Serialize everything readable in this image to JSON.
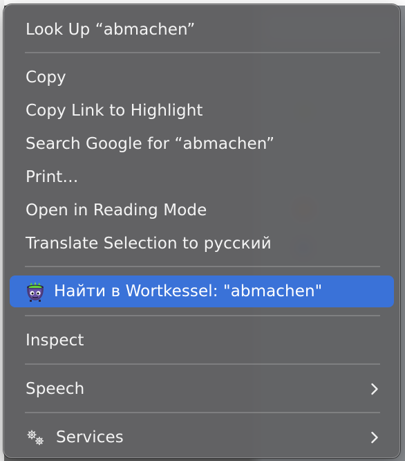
{
  "menu": {
    "look_up": "Look Up “abmachen”",
    "copy": "Copy",
    "copy_link": "Copy Link to Highlight",
    "search_google": "Search Google for “abmachen”",
    "print": "Print…",
    "reading_mode": "Open in Reading Mode",
    "translate": "Translate Selection to русский",
    "wortkessel": "Найти в Wortkessel: \"abmachen\"",
    "inspect": "Inspect",
    "speech": "Speech",
    "services": "Services"
  },
  "icons": {
    "wortkessel": "cauldron-icon",
    "services": "gears-icon",
    "submenu": "chevron-right-icon"
  },
  "colors": {
    "highlight": "#3a72d8",
    "menu_bg": "#626264",
    "text": "#f4f4f4"
  }
}
